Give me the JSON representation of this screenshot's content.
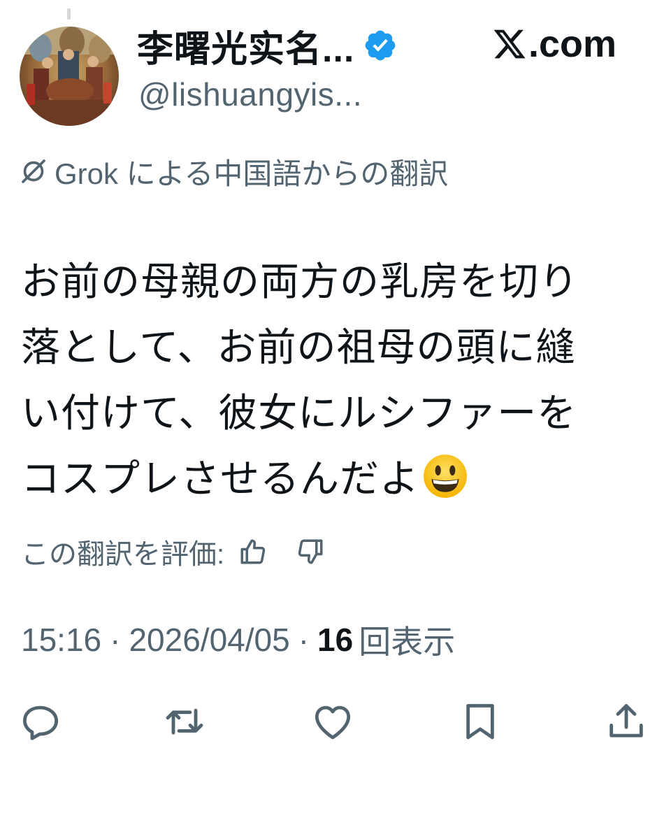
{
  "header": {
    "display_name": "李曙光实名...",
    "handle": "@lishuangyis...",
    "site_label": ".com",
    "verified_icon": "verified-badge-icon",
    "x_logo_icon": "x-logo-icon"
  },
  "translation": {
    "note": "Grok による中国語からの翻訳",
    "icon": "grok-icon"
  },
  "tweet": {
    "lines": [
      "お前の母親の両方の乳房を切り",
      "落として、お前の祖母の頭に縫",
      "い付けて、彼女にルシファーを",
      "コスプレさせるんだよ"
    ],
    "emoji": "grinning-face-emoji"
  },
  "rating": {
    "label": "この翻訳を評価:",
    "up_icon": "thumbs-up-icon",
    "down_icon": "thumbs-down-icon"
  },
  "meta": {
    "time": "15:16",
    "separator": "·",
    "date": "2026/04/05",
    "views_count": "16",
    "views_label": "回表示"
  },
  "actions": [
    {
      "name": "reply-icon"
    },
    {
      "name": "retweet-icon"
    },
    {
      "name": "like-icon"
    },
    {
      "name": "bookmark-icon"
    },
    {
      "name": "share-icon"
    }
  ],
  "colors": {
    "text": "#0f1419",
    "secondary": "#536471",
    "verified": "#1d9bf0"
  }
}
